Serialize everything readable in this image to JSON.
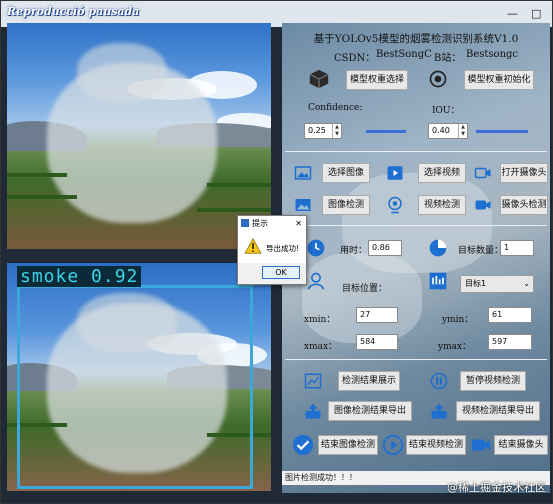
{
  "window": {
    "title": "Reproducció pausada",
    "minimize": "—",
    "maximize": "□"
  },
  "image_top": {
    "label": ""
  },
  "image_bottom": {
    "detection_label": "smoke 0.92"
  },
  "panel": {
    "title": "基于YOLOv5模型的烟雾检测识别系统V1.0",
    "csdn_label": "CSDN：",
    "csdn_value": "BestSongC",
    "bili_label": "B站：",
    "bili_value": "Bestsongc",
    "model_select": "模型权重选择",
    "model_init": "模型权重初始化",
    "confidence_label": "Confidence:",
    "confidence_value": "0.25",
    "confidence_fraction": 0.25,
    "iou_label": "IOU：",
    "iou_value": "0.40",
    "iou_fraction": 0.4,
    "select_image": "选择图像",
    "select_video": "选择视频",
    "open_camera": "打开摄像头",
    "image_detect": "图像检测",
    "video_detect": "视频检测",
    "camera_detect": "摄像头检测",
    "time_label": "用时：",
    "time_value": "0.86",
    "count_label": "目标数量：",
    "count_value": "1",
    "position_label": "目标位置：",
    "target_select": "目标1",
    "xmin_label": "xmin：",
    "xmin_value": "27",
    "ymin_label": "ymin：",
    "ymin_value": "61",
    "xmax_label": "xmax：",
    "xmax_value": "584",
    "ymax_label": "ymax：",
    "ymax_value": "597",
    "show_result": "检测结果展示",
    "pause_video": "暂停视频检测",
    "export_image": "图像检测结果导出",
    "export_video": "视频检测结果导出",
    "end_image": "结束图像检测",
    "end_video": "结束视频检测",
    "end_camera": "结束摄像头"
  },
  "status": {
    "text": "图片检测成功！！！"
  },
  "dialog": {
    "title": "提示",
    "close": "✕",
    "message": "导出成功!",
    "ok": "OK"
  },
  "watermark": {
    "text": "@稀土掘金技术社区"
  }
}
